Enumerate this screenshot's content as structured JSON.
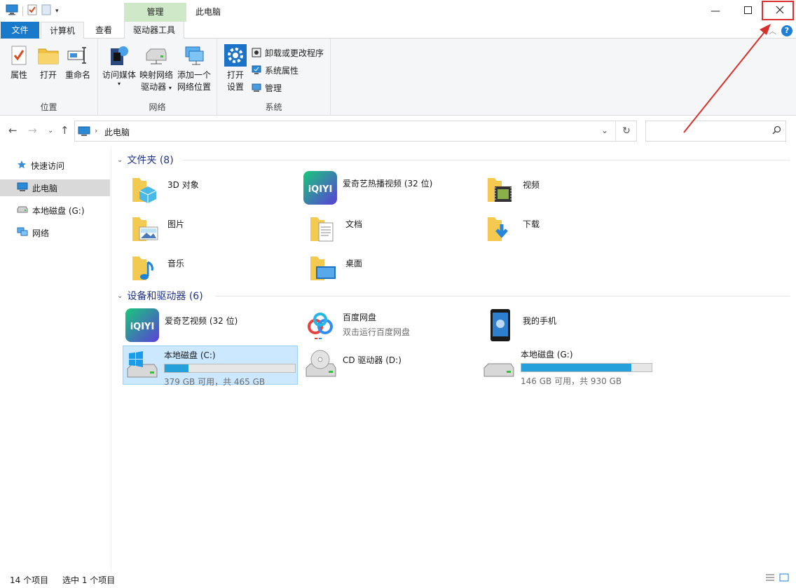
{
  "window": {
    "title": "此电脑",
    "context_tab_group": "管理"
  },
  "tabs": {
    "file": "文件",
    "computer": "计算机",
    "view": "查看",
    "drive_tools": "驱动器工具"
  },
  "ribbon": {
    "location": {
      "name": "位置",
      "properties": "属性",
      "open": "打开",
      "rename": "重命名"
    },
    "network": {
      "name": "网络",
      "access_media": "访问媒体",
      "map_drive_1": "映射网络",
      "map_drive_2": "驱动器",
      "add_location_1": "添加一个",
      "add_location_2": "网络位置"
    },
    "system": {
      "name": "系统",
      "open_settings_1": "打开",
      "open_settings_2": "设置",
      "uninstall": "卸载或更改程序",
      "sys_props": "系统属性",
      "manage": "管理"
    }
  },
  "address": {
    "path": "此电脑",
    "search_placeholder": ""
  },
  "navpane": {
    "items": [
      {
        "label": "快速访问",
        "icon": "star-icon"
      },
      {
        "label": "此电脑",
        "icon": "computer-icon"
      },
      {
        "label": "本地磁盘 (G:)",
        "icon": "drive-icon"
      },
      {
        "label": "网络",
        "icon": "network-icon"
      }
    ]
  },
  "folders": {
    "header": "文件夹 (8)",
    "items": [
      {
        "name": "3D 对象"
      },
      {
        "name": "爱奇艺热播视频 (32 位)"
      },
      {
        "name": "视频"
      },
      {
        "name": "图片"
      },
      {
        "name": "文档"
      },
      {
        "name": "下载"
      },
      {
        "name": "音乐"
      },
      {
        "name": "桌面"
      }
    ]
  },
  "devices": {
    "header": "设备和驱动器 (6)",
    "items": [
      {
        "name": "爱奇艺视频 (32 位)",
        "sub": ""
      },
      {
        "name": "百度网盘",
        "sub": "双击运行百度网盘"
      },
      {
        "name": "我的手机",
        "sub": ""
      }
    ],
    "drives": [
      {
        "name": "本地磁盘 (C:)",
        "free": "379 GB 可用，共 465 GB",
        "used_fraction": 0.185
      },
      {
        "name": "CD 驱动器 (D:)"
      },
      {
        "name": "本地磁盘 (G:)",
        "free": "146 GB 可用，共 930 GB",
        "used_fraction": 0.843
      }
    ]
  },
  "status": {
    "count": "14 个项目",
    "selected": "选中 1 个项目"
  },
  "colors": {
    "accent": "#1979ca",
    "selection": "#cce8ff",
    "drive_bar": "#26a0da",
    "annotation": "#d9302d"
  }
}
